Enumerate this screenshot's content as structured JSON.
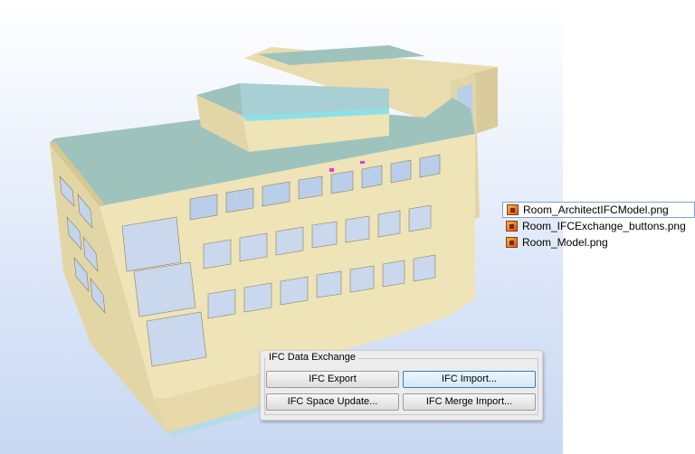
{
  "files": [
    {
      "name": "Room_ArchitectIFCModel.png",
      "selected": true
    },
    {
      "name": "Room_IFCExchange_buttons.png",
      "selected": false
    },
    {
      "name": "Room_Model.png",
      "selected": false
    }
  ],
  "ifc_panel": {
    "title": "IFC  Data  Exchange",
    "buttons": {
      "export": "IFC Export",
      "import": "IFC Import...",
      "space_update": "IFC Space Update...",
      "merge_import": "IFC Merge Import..."
    }
  },
  "colors": {
    "wall": "#efe3b8",
    "roof": "#9ec3bc",
    "window": "#b9cee9"
  }
}
